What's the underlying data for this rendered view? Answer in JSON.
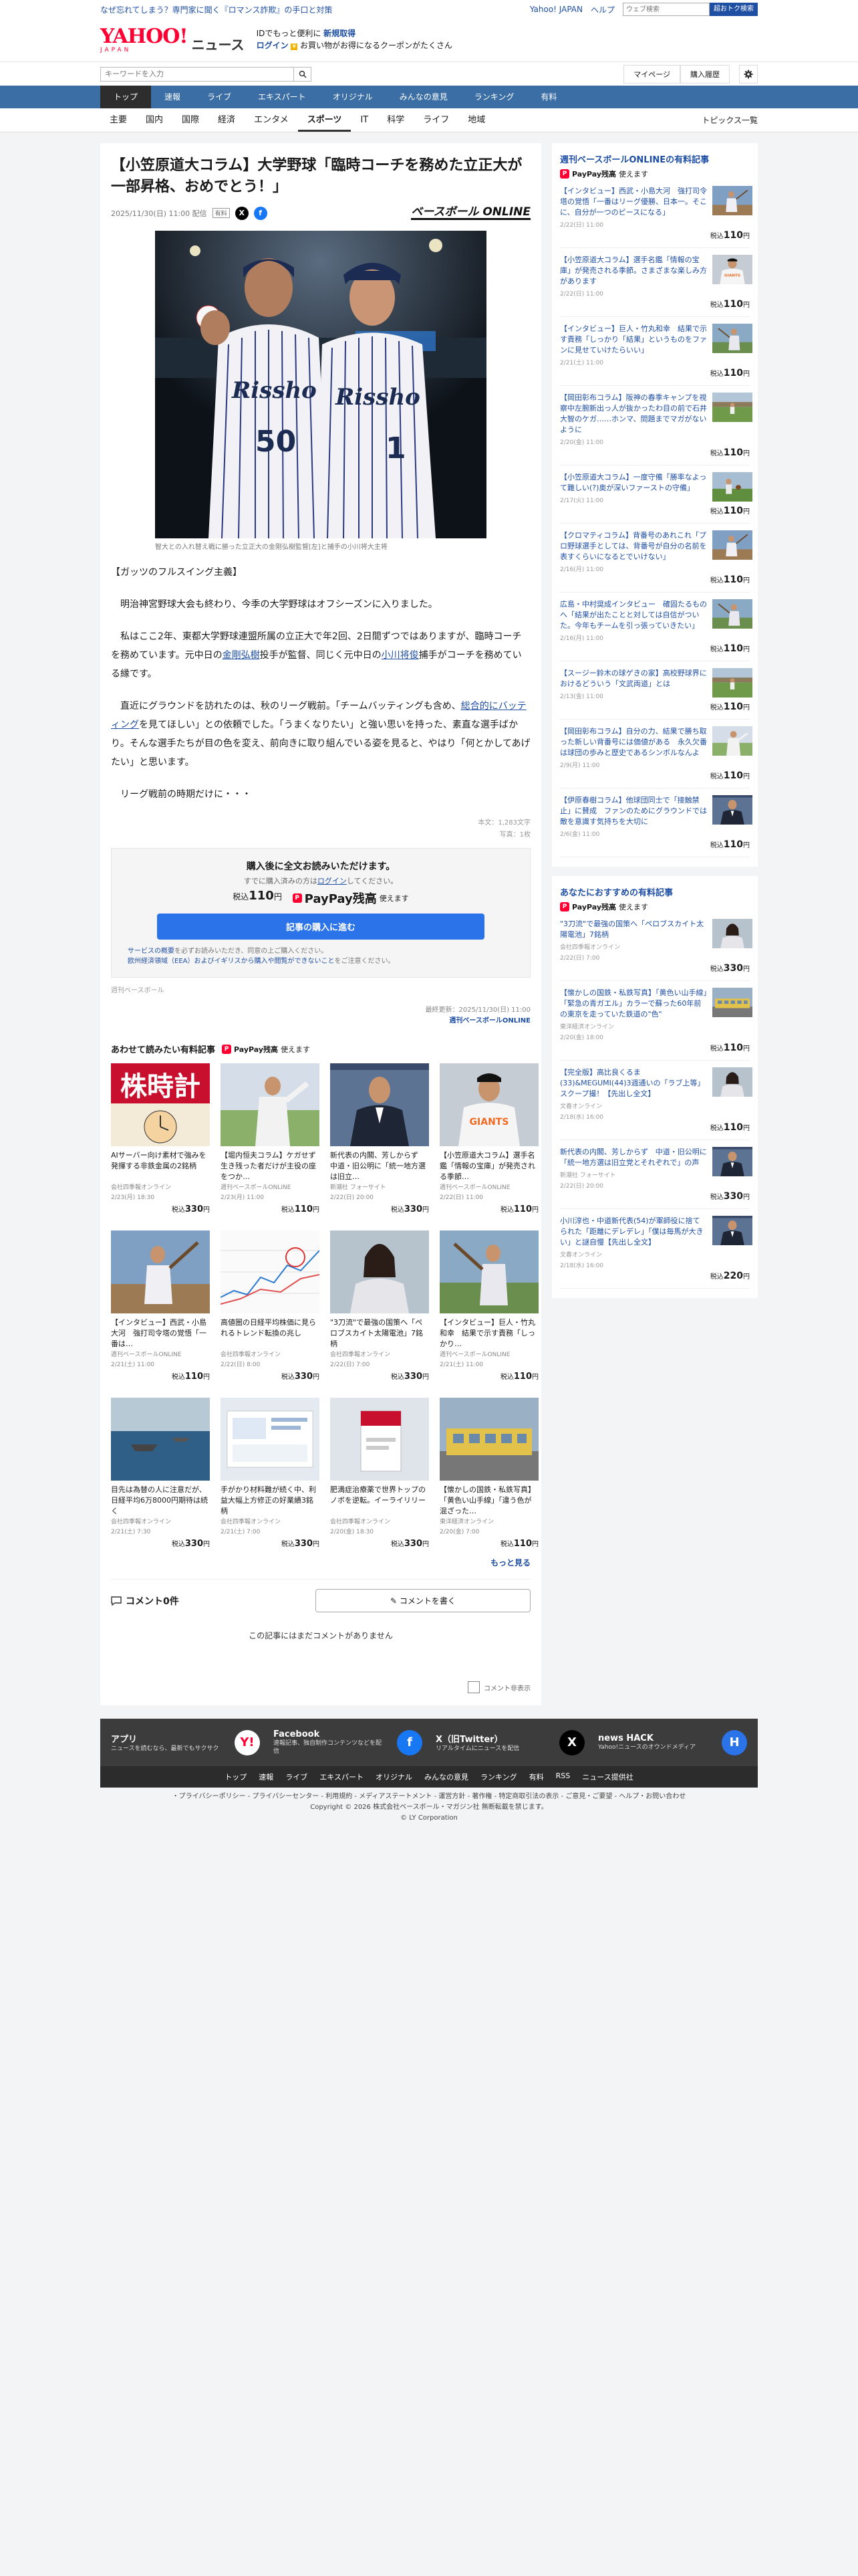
{
  "topline": {
    "promo": "なぜ忘れてしまう？専門家に聞く『ロマンス詐欺』の手口と対策",
    "yahoo": "Yahoo! JAPAN",
    "help": "ヘルプ",
    "search_placeholder": "ウェブ検索",
    "search_btn": "超おトク検索"
  },
  "masthead": {
    "logo_main": "YAHOO!",
    "logo_sub": "JAPAN",
    "news": "ニュース",
    "line1_pre": "IDでもっと便利に",
    "line1_strong": "新規取得",
    "line2_login": "ログイン",
    "line2_rest": "お買い物がお得になるクーポンがたくさん"
  },
  "searchbar": {
    "placeholder": "キーワードを入力",
    "mypage": "マイページ",
    "history": "購入履歴"
  },
  "mainnav": [
    "トップ",
    "速報",
    "ライブ",
    "エキスパート",
    "オリジナル",
    "みんなの意見",
    "ランキング",
    "有料"
  ],
  "subnav": {
    "cats": [
      "主要",
      "国内",
      "国際",
      "経済",
      "エンタメ",
      "スポーツ",
      "IT",
      "科学",
      "ライフ",
      "地域"
    ],
    "active": 5,
    "topics": "トピックス一覧"
  },
  "article": {
    "title": "【小笠原道大コラム】大学野球「臨時コーチを務めた立正大が一部昇格、おめでとう！」",
    "date": "2025/11/30(日) 11:00 配信",
    "tag": "有料",
    "publisher_logo": "ベースボール ONLINE",
    "caption": "智大との入れ替え戦に勝った立正大の金剛弘樹監督[左]と捕手の小川将大主将",
    "jersey_left": "50",
    "jersey_right": "1",
    "uni_script": "Rissho",
    "lead": "【ガッツのフルスイング主義】",
    "p1": "明治神宮野球大会も終わり、今季の大学野球はオフシーズンに入りました。",
    "p2a": "私はここ2年、東都大学野球連盟所属の立正大で年2回、2日間ずつではありますが、臨時コーチを務めています。元中日の",
    "p2link1": "金剛弘樹",
    "p2b": "投手が監督、同じく元中日の",
    "p2link2": "小川将俊",
    "p2c": "捕手がコーチを務めている縁です。",
    "p3a": "直近にグラウンドを訪れたのは、秋のリーグ戦前。「チームバッティングも含め、",
    "p3link": "総合的にバッティング",
    "p3b": "を見てほしい」との依頼でした。「うまくなりたい」と強い思いを持った、素直な選手ばかり。そんな選手たちが目の色を変え、前向きに取り組んでいる姿を見ると、やはり「何とかしてあげたい」と思います。",
    "p4": "リーグ戦前の時期だけに・・・",
    "chars": "本文：1,283文字",
    "photos": "写真：1枚",
    "buy_title": "購入後に全文お読みいただけます。",
    "buy_sub_pre": "すでに購入済みの方は",
    "buy_sub_link": "ログイン",
    "buy_sub_post": "してください。",
    "price_pre": "税込",
    "price": "110",
    "price_unit": "円",
    "paypay": "PayPay残高",
    "paypay_use": "使えます",
    "buy_btn": "記事の購入に進む",
    "note1_link": "サービスの概要",
    "note1": "を必ずお読みいただき、同意の上ご購入ください。",
    "note2_link": "欧州経済領域（EEA）およびイギリスから購入や閲覧ができないこと",
    "note2": "をご注意ください。",
    "publisher_small": "週刊ベースボール",
    "updated": "最終更新：2025/11/30(日) 11:00",
    "updated_src": "週刊ベースボールONLINE"
  },
  "related": {
    "heading": "あわせて読みたい有料記事",
    "paypay": "PayPay残高",
    "paypay_use": "使えます",
    "items": [
      {
        "title": "AIサーバー向け素材で強みを発揮する非鉄金属の2銘柄",
        "src": "会社四季報オンライン",
        "date": "2/23(月) 18:30",
        "price": "330",
        "img": "tokei",
        "thumb_text": "株時計"
      },
      {
        "title": "【堀内恒夫コラム】ケガせず生き残った者だけが主役の座をつか…",
        "src": "週刊ベースボールONLINE",
        "date": "2/23(月) 11:00",
        "price": "110",
        "img": "pitcher"
      },
      {
        "title": "新代表の内閣、芳しからず　中道・旧公明に「統一地方選は旧立…",
        "src": "新潮社 フォーサイト",
        "date": "2/22(日) 20:00",
        "price": "330",
        "img": "suit"
      },
      {
        "title": "【小笠原道大コラム】選手名鑑「情報の宝庫」が発売される季節…",
        "src": "週刊ベースボールONLINE",
        "date": "2/22(日) 11:00",
        "price": "110",
        "img": "giants"
      },
      {
        "title": "【インタビュー】西武・小島大河　強打司令塔の覚悟「一番は…",
        "src": "週刊ベースボールONLINE",
        "date": "2/21(土) 11:00",
        "price": "110",
        "img": "batter"
      },
      {
        "title": "高値圏の日経平均株価に見られるトレンド転換の兆し",
        "src": "会社四季報オンライン",
        "date": "2/22(日) 8:00",
        "price": "330",
        "img": "chart"
      },
      {
        "title": "\"3刀流\"で最強の国策へ「ペロブスカイト太陽電池」7銘柄",
        "src": "会社四季報オンライン",
        "date": "2/22(日) 7:00",
        "price": "330",
        "img": "woman"
      },
      {
        "title": "【インタビュー】巨人・竹丸和幸　結果で示す責務「しっかり…",
        "src": "週刊ベースボールONLINE",
        "date": "2/21(土) 11:00",
        "price": "110",
        "img": "batter2"
      },
      {
        "title": "目先は為替の人に注意だが、日経平均6万8000円期待は続く",
        "src": "会社四季報オンライン",
        "date": "2/21(土) 7:30",
        "price": "330",
        "img": "sea"
      },
      {
        "title": "手がかり材料難が続く中、利益大幅上方修正の好業績3銘柄",
        "src": "会社四季報オンライン",
        "date": "2/21(土) 7:00",
        "price": "330",
        "img": "office"
      },
      {
        "title": "肥満症治療薬で世界トップのノボを逆転。イーライリリー",
        "src": "会社四季報オンライン",
        "date": "2/20(金) 18:30",
        "price": "330",
        "img": "pharma"
      },
      {
        "title": "【懐かしの国鉄・私鉄写真】「黄色い山手線」「違う色が混ざった…",
        "src": "東洋経済オンライン",
        "date": "2/20(金) 7:00",
        "price": "110",
        "img": "train"
      }
    ],
    "more": "もっと見る"
  },
  "comments": {
    "title": "コメント0件",
    "write": "コメントを書く",
    "none": "この記事にはまだコメントがありません",
    "hide": "コメント非表示"
  },
  "sidebar": {
    "sec1_title": "週刊ベースボールONLINEの有料記事",
    "sec2_title": "あなたにおすすめの有料記事",
    "paypay": "PayPay残高",
    "paypay_use": "使えます",
    "price_pre": "税込",
    "price_unit": "円",
    "sec1": [
      {
        "title": "【インタビュー】西武・小島大河　強打司令塔の覚悟「一番はリーグ優勝、日本一。そこに、自分が一つのピースになる」",
        "date": "2/22(日) 11:00",
        "price": "110",
        "img": "batter"
      },
      {
        "title": "【小笠原道大コラム】選手名鑑「情報の宝庫」が発売される季節。さまざまな楽しみ方があります",
        "date": "2/22(日) 11:00",
        "price": "110",
        "img": "giants"
      },
      {
        "title": "【インタビュー】巨人・竹丸和幸　結果で示す責務「しっかり「結果」というものをファンに見せていけたらいい」",
        "date": "2/21(土) 11:00",
        "price": "110",
        "img": "batter2"
      },
      {
        "title": "【岡田彰布コラム】阪神の春季キャンプを視察中左腕新出っ人が抜かったわ目の前で石井大智のケガ……ホンマ、問題までマガがないように",
        "date": "2/20(金) 11:00",
        "price": "110",
        "img": "field"
      },
      {
        "title": "【小笠原道大コラム】一度守備「勝率なよって難しい(?)奥が深いファーストの守備」",
        "date": "2/17(火) 11:00",
        "price": "110",
        "img": "field2"
      },
      {
        "title": "【クロマティコラム】背番号のあれこれ「プロ野球選手としては、背番号が自分の名前を表すくらいになるとでいけない」",
        "date": "2/16(月) 11:00",
        "price": "110",
        "img": "batter"
      },
      {
        "title": "広島・中村奨成インタビュー　確固たるものへ「結果が出たことと対しては自信がついた。今年もチームを引っ張っていきたい」",
        "date": "2/16(月) 11:00",
        "price": "110",
        "img": "batter2"
      },
      {
        "title": "【スージー鈴木の球ゲきの家】高校野球界におけるどういう「文武両道」とは",
        "date": "2/13(金) 11:00",
        "price": "110",
        "img": "field"
      },
      {
        "title": "【岡田彰布コラム】自分の力、結果で勝ち取った新しい背番号には価値がある　永久欠番は球団の歩みと歴史であるシンボルなんよ",
        "date": "2/9(月) 11:00",
        "price": "110",
        "img": "pitcher"
      },
      {
        "title": "【伊原春樹コラム】他球団同士で「接触禁止」に賛成　ファンのためにグラウンドでは敵を意識す気持ちを大切に",
        "date": "2/6(金) 11:00",
        "price": "110",
        "img": "suit"
      }
    ],
    "sec2": [
      {
        "title": "\"3刀流\"で最強の国策へ「ペロブスカイト太陽電池」7銘柄",
        "src": "会社四季報オンライン",
        "date": "2/22(日) 7:00",
        "price": "330",
        "img": "woman"
      },
      {
        "title": "【懐かしの国鉄・私鉄写真】「黄色い山手線」「緊急の青ガエル」カラーで蘇った60年前の東京を走っていた鉄道の\"色\"",
        "src": "東洋経済オンライン",
        "date": "2/20(金) 18:00",
        "price": "110",
        "img": "train"
      },
      {
        "title": "【完全版】高比良くるま(33)&MEGUMI(44)3週通いの「ラブ上等」スクープ撮！【先出し全文】",
        "src": "文春オンライン",
        "date": "2/18(水) 16:00",
        "price": "110",
        "img": "woman"
      },
      {
        "title": "新代表の内閣、芳しからず　中道・旧公明に「統一地方選は旧立党とそれぞれで」の声",
        "src": "新潮社 フォーサイト",
        "date": "2/22(日) 20:00",
        "price": "330",
        "img": "suit"
      },
      {
        "title": "小川淳也・中道新代表(54)が軍師役に捨てられた「距離にデレデレ」「僕は毎馬が大きい」と謎自慢【先出し全文】",
        "src": "文春オンライン",
        "date": "2/18(水) 16:00",
        "price": "220",
        "img": "suit"
      }
    ]
  },
  "footer": {
    "cards": [
      {
        "title": "アプリ",
        "sub": "ニュースを読むなら、最新でもサクサク",
        "icon": "Y!"
      },
      {
        "title": "Facebook",
        "sub": "速報記事、独自制作コンテンツなどを配信",
        "icon": "f"
      },
      {
        "title": "X（旧Twitter）",
        "sub": "リアルタイムにニュースを配信",
        "icon": "X"
      },
      {
        "title": "news HACK",
        "sub": "Yahoo!ニュースのオウンドメディア",
        "icon": "H"
      }
    ],
    "nav": [
      "トップ",
      "速報",
      "ライブ",
      "エキスパート",
      "オリジナル",
      "みんなの意見",
      "ランキング",
      "有料",
      "RSS",
      "ニュース提供社"
    ],
    "legal1": "・プライバシーポリシー - プライバシーセンター - 利用規約 - メディアステートメント - 運営方針 - 著作権 - 特定商取引法の表示 - ご意見・ご要望 - ヘルプ・お問い合わせ",
    "legal2": "Copyright © 2026 株式会社ベースボール・マガジン社 無断転載を禁じます。",
    "legal3": "© LY Corporation"
  },
  "colors": {
    "brand_red": "#ff0033",
    "nav_blue": "#3a6ea5",
    "link_blue": "#1f4fa3",
    "buy_blue": "#2a73e8"
  }
}
